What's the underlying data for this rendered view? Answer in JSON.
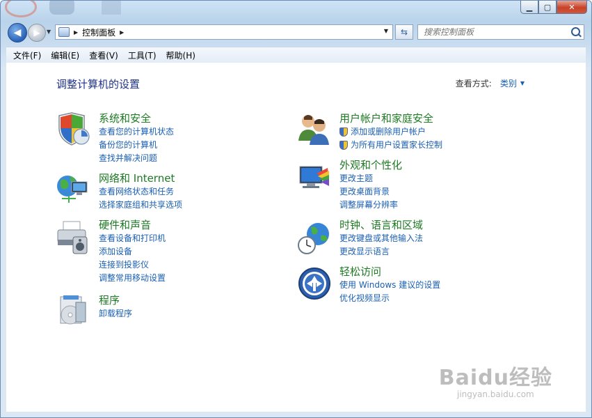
{
  "window": {
    "caption_buttons": [
      "minimize-icon",
      "maximize-icon",
      "close-icon"
    ]
  },
  "address_bar": {
    "path": "控制面板",
    "search_placeholder": "搜索控制面板"
  },
  "menu": [
    "文件(F)",
    "编辑(E)",
    "查看(V)",
    "工具(T)",
    "帮助(H)"
  ],
  "page": {
    "title": "调整计算机的设置",
    "view_by_label": "查看方式:",
    "view_by_value": "类别"
  },
  "categories_left": [
    {
      "title": "系统和安全",
      "icon": "shield-icon",
      "links": [
        "查看您的计算机状态",
        "备份您的计算机",
        "查找并解决问题"
      ]
    },
    {
      "title": "网络和 Internet",
      "icon": "network-globe-icon",
      "links": [
        "查看网络状态和任务",
        "选择家庭组和共享选项"
      ]
    },
    {
      "title": "硬件和声音",
      "icon": "printer-speaker-icon",
      "links": [
        "查看设备和打印机",
        "添加设备",
        "连接到投影仪",
        "调整常用移动设置"
      ]
    },
    {
      "title": "程序",
      "icon": "programs-disc-icon",
      "links": [
        "卸载程序"
      ]
    }
  ],
  "categories_right": [
    {
      "title": "用户帐户和家庭安全",
      "icon": "user-accounts-icon",
      "links": [
        "添加或删除用户帐户",
        "为所有用户设置家长控制"
      ],
      "shield_links": true
    },
    {
      "title": "外观和个性化",
      "icon": "monitor-palette-icon",
      "links": [
        "更改主题",
        "更改桌面背景",
        "调整屏幕分辨率"
      ]
    },
    {
      "title": "时钟、语言和区域",
      "icon": "clock-globe-icon",
      "links": [
        "更改键盘或其他输入法",
        "更改显示语言"
      ]
    },
    {
      "title": "轻松访问",
      "icon": "ease-of-access-icon",
      "links": [
        "使用 Windows 建议的设置",
        "优化视频显示"
      ]
    }
  ],
  "watermark": {
    "logo": "Baidu经验",
    "url": "jingyan.baidu.com"
  }
}
